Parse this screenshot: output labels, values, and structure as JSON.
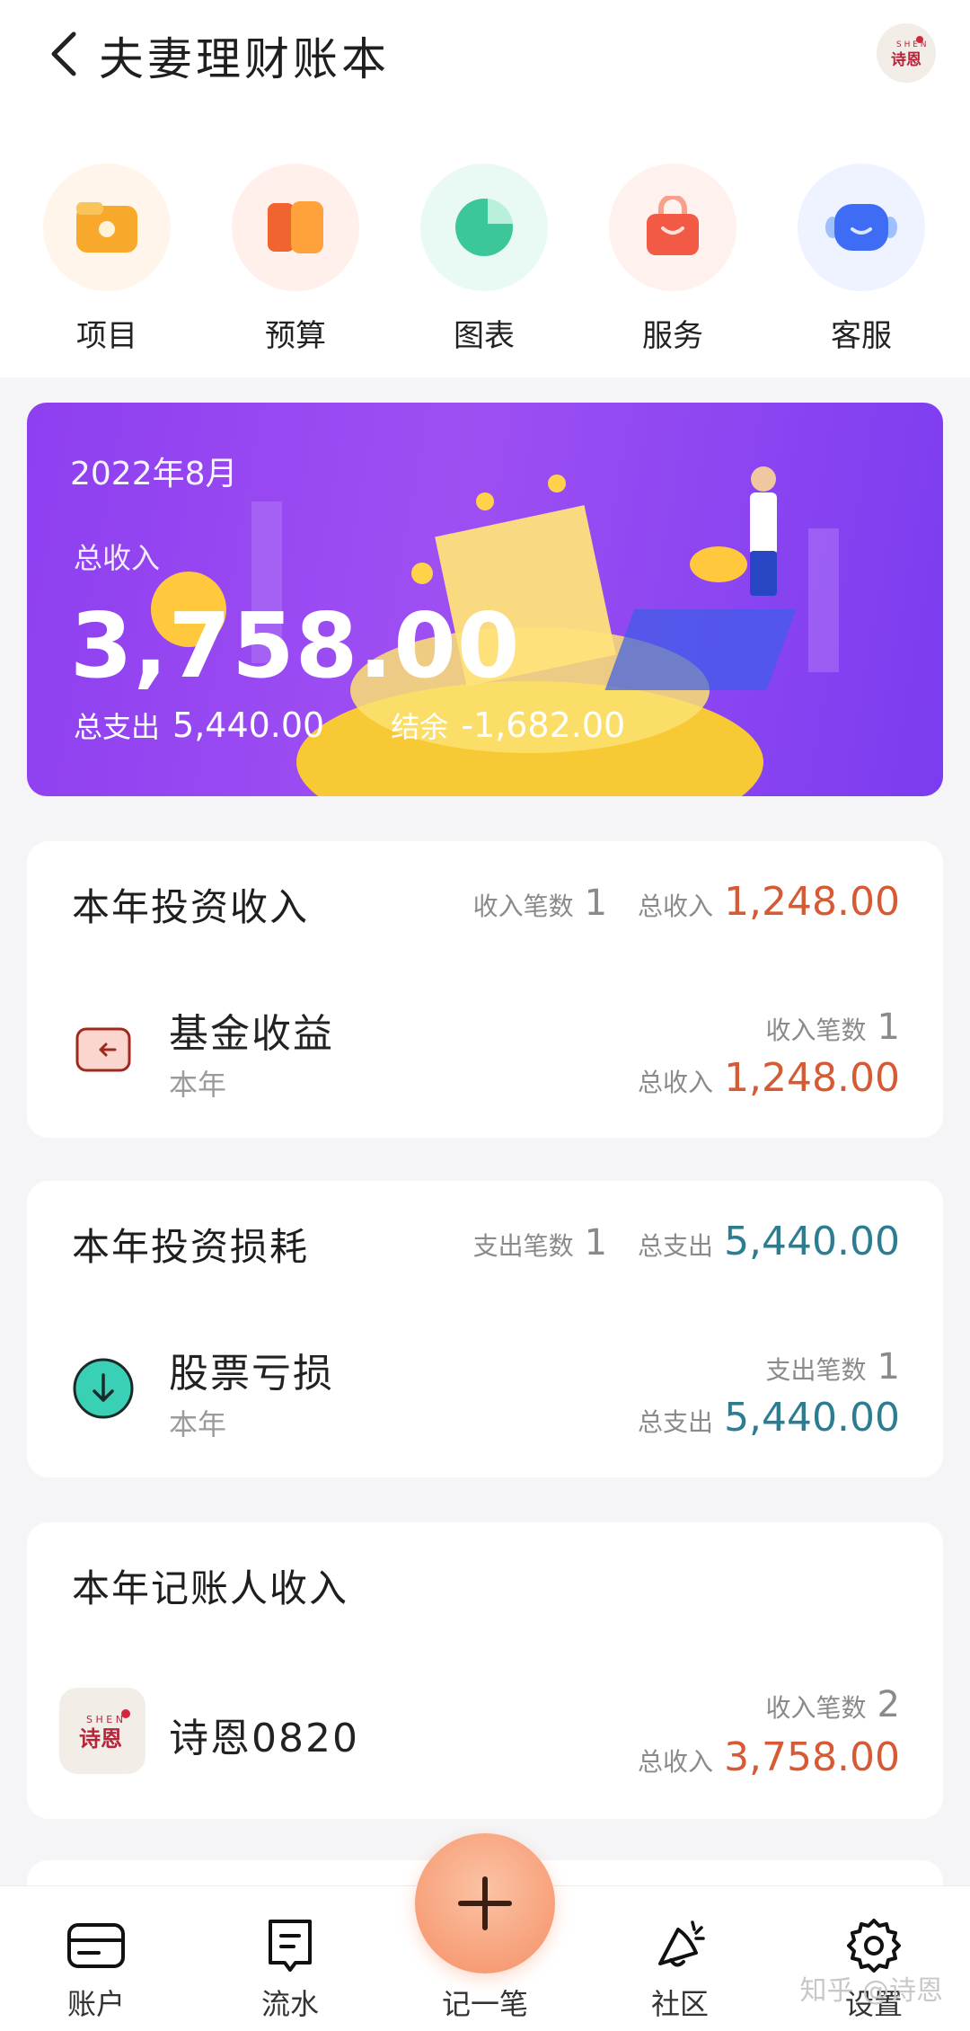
{
  "header": {
    "title": "夫妻理财账本",
    "avatar_text": "诗恩",
    "avatar_small": "SH EN"
  },
  "quick_actions": [
    {
      "label": "项目",
      "icon": "folder-icon"
    },
    {
      "label": "预算",
      "icon": "budget-icon"
    },
    {
      "label": "图表",
      "icon": "pie-chart-icon"
    },
    {
      "label": "服务",
      "icon": "shopping-bag-icon"
    },
    {
      "label": "客服",
      "icon": "robot-icon"
    }
  ],
  "banner": {
    "month": "2022年8月",
    "income_label": "总收入",
    "income_value": "3,758.00",
    "expense_label": "总支出",
    "expense_value": "5,440.00",
    "balance_label": "结余",
    "balance_value": "-1,682.00"
  },
  "cards": {
    "invest_income": {
      "title": "本年投资收入",
      "count_label": "收入笔数",
      "count": "1",
      "total_label": "总收入",
      "total": "1,248.00",
      "item": {
        "name": "基金收益",
        "sub": "本年",
        "count_label": "收入笔数",
        "count": "1",
        "total_label": "总收入",
        "total": "1,248.00"
      }
    },
    "invest_loss": {
      "title": "本年投资损耗",
      "count_label": "支出笔数",
      "count": "1",
      "total_label": "总支出",
      "total": "5,440.00",
      "item": {
        "name": "股票亏损",
        "sub": "本年",
        "count_label": "支出笔数",
        "count": "1",
        "total_label": "总支出",
        "total": "5,440.00"
      }
    },
    "bookkeeper_income": {
      "title": "本年记账人收入",
      "item": {
        "name": "诗恩0820",
        "count_label": "收入笔数",
        "count": "2",
        "total_label": "总收入",
        "total": "3,758.00"
      }
    }
  },
  "tabbar": [
    {
      "label": "账户",
      "icon": "wallet-card-icon"
    },
    {
      "label": "流水",
      "icon": "receipt-icon"
    },
    {
      "label": "记一笔",
      "icon": "plus-icon"
    },
    {
      "label": "社区",
      "icon": "community-icon"
    },
    {
      "label": "设置",
      "icon": "gear-icon"
    }
  ],
  "watermark": "知乎 @诗恩",
  "colors": {
    "income": "#d65a34",
    "expense": "#2c7d92",
    "banner": "#8e3ff0",
    "fab": "#f79f78"
  }
}
